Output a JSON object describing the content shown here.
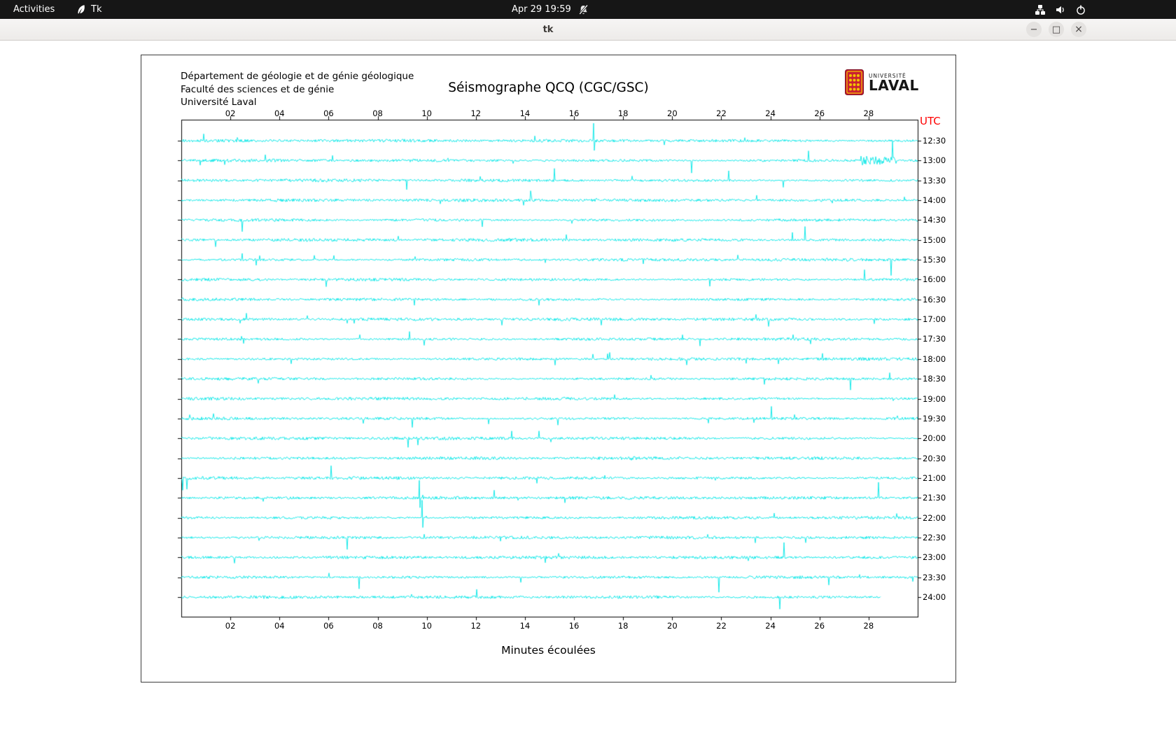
{
  "topbar": {
    "activities_label": "Activities",
    "app_label": "Tk",
    "clock": "Apr 29 19:59"
  },
  "window": {
    "title": "tk",
    "controls": {
      "minimize": "−",
      "maximize": "□",
      "close": "×"
    }
  },
  "header": {
    "address_lines": [
      "Département de géologie et de génie géologique",
      "Faculté des sciences et de génie",
      "Université Laval"
    ],
    "title": "Séismographe QCQ (CGC/GSC)",
    "logo": {
      "line1": "UNIVERSITÉ",
      "line2": "LAVAL"
    }
  },
  "chart_data": {
    "type": "line",
    "title": "Séismographe QCQ (CGC/GSC)",
    "xlabel": "Minutes écoulées",
    "right_axis_title": "UTC",
    "x_ticks": [
      "02",
      "04",
      "06",
      "08",
      "10",
      "12",
      "14",
      "16",
      "18",
      "20",
      "22",
      "24",
      "26",
      "28"
    ],
    "x_tick_step_minutes": 2,
    "x_range_minutes": [
      0,
      30
    ],
    "rows": 24,
    "minutes_per_row": 30,
    "row_labels": [
      "12:30",
      "13:00",
      "13:30",
      "14:00",
      "14:30",
      "15:00",
      "15:30",
      "16:00",
      "16:30",
      "17:00",
      "17:30",
      "18:00",
      "18:30",
      "19:00",
      "19:30",
      "20:00",
      "20:30",
      "21:00",
      "21:30",
      "22:00",
      "22:30",
      "23:00",
      "23:30",
      "24:00"
    ],
    "last_row_end_minute": 28.5,
    "trace_color": "#00e6e6",
    "axis_color": "#000000",
    "utc_label_color": "#ff0000",
    "events": [
      {
        "row": 0,
        "minute": 16.8,
        "type": "spike"
      },
      {
        "row": 1,
        "minute": 28.4,
        "type": "burst"
      },
      {
        "row": 18,
        "minute": 9.7,
        "type": "spike"
      },
      {
        "row": 19,
        "minute": 9.8,
        "type": "spike"
      }
    ]
  }
}
